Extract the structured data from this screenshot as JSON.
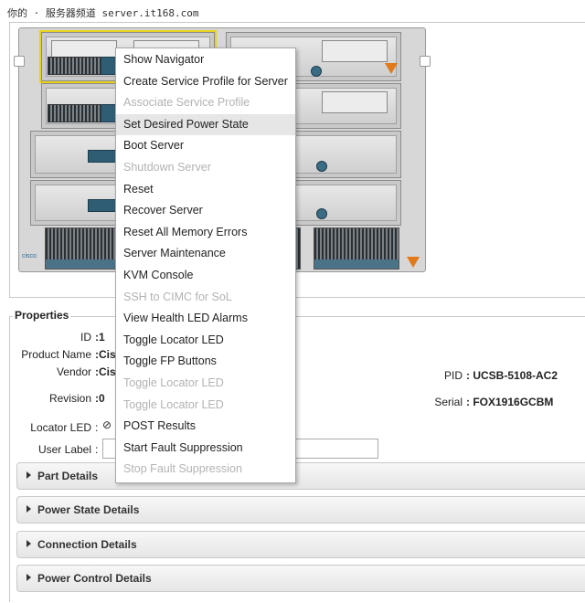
{
  "watermark": "你的 · 服务器频道 server.it168.com",
  "context_menu": {
    "items": [
      {
        "label": "Show Navigator",
        "enabled": true
      },
      {
        "label": "Create Service Profile for Server",
        "enabled": true
      },
      {
        "label": "Associate Service Profile",
        "enabled": false
      },
      {
        "label": "Set Desired Power State",
        "enabled": true,
        "highlighted": true
      },
      {
        "label": "Boot Server",
        "enabled": true
      },
      {
        "label": "Shutdown Server",
        "enabled": false
      },
      {
        "label": "Reset",
        "enabled": true
      },
      {
        "label": "Recover Server",
        "enabled": true
      },
      {
        "label": "Reset All Memory Errors",
        "enabled": true
      },
      {
        "label": "Server Maintenance",
        "enabled": true
      },
      {
        "label": "KVM Console",
        "enabled": true
      },
      {
        "label": "SSH to CIMC for SoL",
        "enabled": false
      },
      {
        "label": "View Health LED Alarms",
        "enabled": true
      },
      {
        "label": "Toggle Locator LED",
        "enabled": true
      },
      {
        "label": "Toggle FP Buttons",
        "enabled": true
      },
      {
        "label": "Toggle Locator LED",
        "enabled": false
      },
      {
        "label": "Toggle Locator LED",
        "enabled": false
      },
      {
        "label": "POST Results",
        "enabled": true
      },
      {
        "label": "Start Fault Suppression",
        "enabled": true
      },
      {
        "label": "Stop Fault Suppression",
        "enabled": false
      }
    ]
  },
  "chassis": {
    "logo_text": "cisco"
  },
  "properties": {
    "title": "Properties",
    "id_label": "ID",
    "id_value": ":1",
    "product_name_label": "Product Name",
    "product_name_value": ":Cis",
    "vendor_label": "Vendor",
    "vendor_value": ":Cis",
    "revision_label": "Revision",
    "revision_value": ":0",
    "locator_led_label": "Locator LED",
    "locator_led_value": ":",
    "user_label_label": "User Label",
    "user_label_colon": ":",
    "user_label_value": "",
    "pid_label": "PID",
    "pid_value": ": UCSB-5108-AC2",
    "serial_label": "Serial",
    "serial_value": ": FOX1916GCBM"
  },
  "sections": [
    {
      "title": "Part Details"
    },
    {
      "title": "Power State Details"
    },
    {
      "title": "Connection Details"
    },
    {
      "title": "Power Control Details"
    }
  ]
}
